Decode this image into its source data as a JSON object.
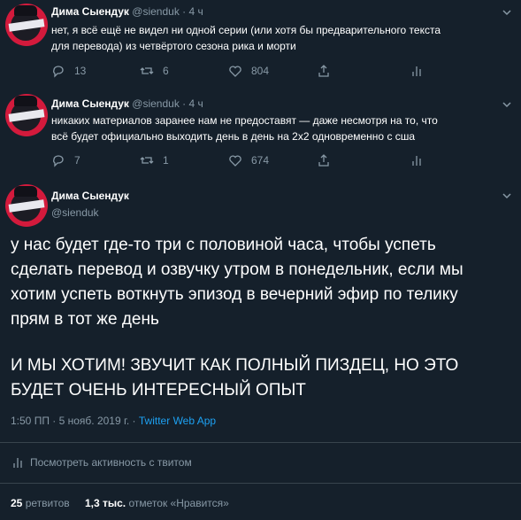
{
  "tweets": [
    {
      "name": "Дима Сыендук",
      "handle": "@sienduk",
      "time": "· 4 ч",
      "lines": [
        "нет, я всё ещё не видел ни одной серии (или хотя бы предварительного текста",
        "для перевода) из четвёртого сезона рика и морти"
      ],
      "replies": "13",
      "retweets": "6",
      "likes": "804"
    },
    {
      "name": "Дима Сыендук",
      "handle": "@sienduk",
      "time": "· 4 ч",
      "lines": [
        "никаких материалов заранее нам не предоставят — даже несмотря на то, что",
        "всё будет официально выходить день в день на 2х2 одновременно с сша"
      ],
      "replies": "7",
      "retweets": "1",
      "likes": "674"
    }
  ],
  "main": {
    "name": "Дима Сыендук",
    "handle": "@sienduk",
    "paragraph1": [
      "у нас будет где-то три с половиной часа, чтобы успеть",
      "сделать перевод и озвучку утром в понедельник, если мы",
      "хотим успеть воткнуть эпизод в вечерний эфир по телику",
      "прям в тот же день"
    ],
    "paragraph2": [
      "И МЫ ХОТИМ! ЗВУЧИТ КАК ПОЛНЫЙ ПИЗДЕЦ, НО ЭТО",
      "БУДЕТ ОЧЕНЬ ИНТЕРЕСНЫЙ ОПЫТ"
    ],
    "timestamp": "1:50 ПП · 5 нояб. 2019 г. · ",
    "source": "Twitter Web App",
    "activity": "Посмотреть активность с твитом",
    "retweet_count": "25",
    "retweet_label": " ретвитов",
    "like_count": "1,3 тыс.",
    "like_label": " отметок «Нравится»"
  },
  "icons": [
    "chevron-down-icon",
    "reply-icon",
    "retweet-icon",
    "like-icon",
    "share-icon",
    "analytics-icon"
  ]
}
